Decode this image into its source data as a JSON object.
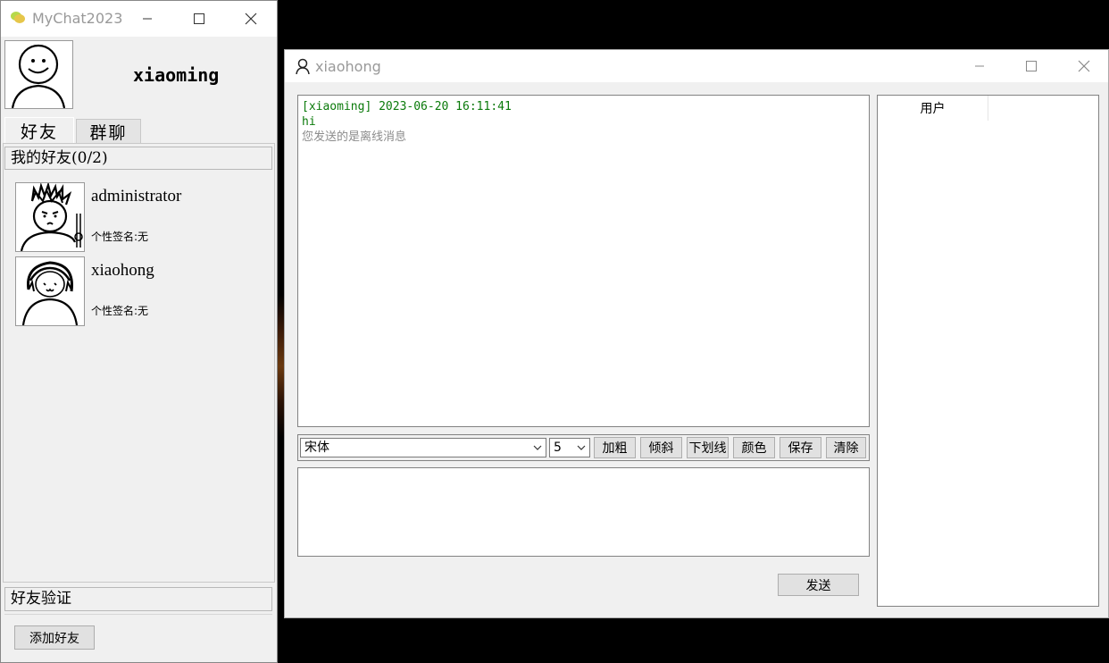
{
  "main_window": {
    "title": "MyChat2023",
    "username": "xiaoming",
    "tabs": [
      {
        "label": "好友",
        "active": true
      },
      {
        "label": "群聊",
        "active": false
      }
    ],
    "friends_header": "我的好友(0/2)",
    "friends": [
      {
        "name": "administrator",
        "signature": "个性签名:无"
      },
      {
        "name": "xiaohong",
        "signature": "个性签名:无"
      }
    ],
    "verify_header": "好友验证",
    "add_friend_button": "添加好友"
  },
  "chat_window": {
    "title": "xiaohong",
    "messages": [
      {
        "header": "[xiaoming] 2023-06-20 16:11:41",
        "body": "hi",
        "note": "您发送的是离线消息"
      }
    ],
    "font_select": "宋体",
    "size_select": "5",
    "format_buttons": [
      "加粗",
      "倾斜",
      "下划线",
      "颜色",
      "保存",
      "清除"
    ],
    "send_button": "发送",
    "user_list_header": "用户"
  },
  "colors": {
    "message_text": "#0a7a0a",
    "note_text": "#8c8c8c",
    "window_bg": "#f0f0f0"
  }
}
